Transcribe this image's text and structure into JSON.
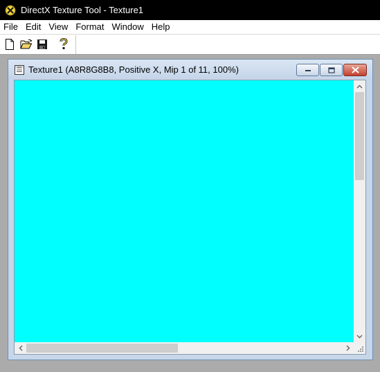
{
  "app": {
    "title": "DirectX Texture Tool - Texture1",
    "icon": "directx-icon"
  },
  "menu": {
    "items": [
      "File",
      "Edit",
      "View",
      "Format",
      "Window",
      "Help"
    ]
  },
  "toolbar": {
    "buttons": [
      {
        "name": "new",
        "icon": "new-document-icon"
      },
      {
        "name": "open",
        "icon": "open-folder-icon"
      },
      {
        "name": "save",
        "icon": "save-disk-icon"
      },
      {
        "name": "help",
        "icon": "help-question-icon"
      }
    ]
  },
  "document": {
    "title": "Texture1 (A8R8G8B8, Positive X, Mip 1 of 11, 100%)",
    "icon": "dds-document-icon",
    "fill_color": "#00ffff"
  },
  "scroll": {
    "vertical_position": 0,
    "horizontal_position": 0
  }
}
